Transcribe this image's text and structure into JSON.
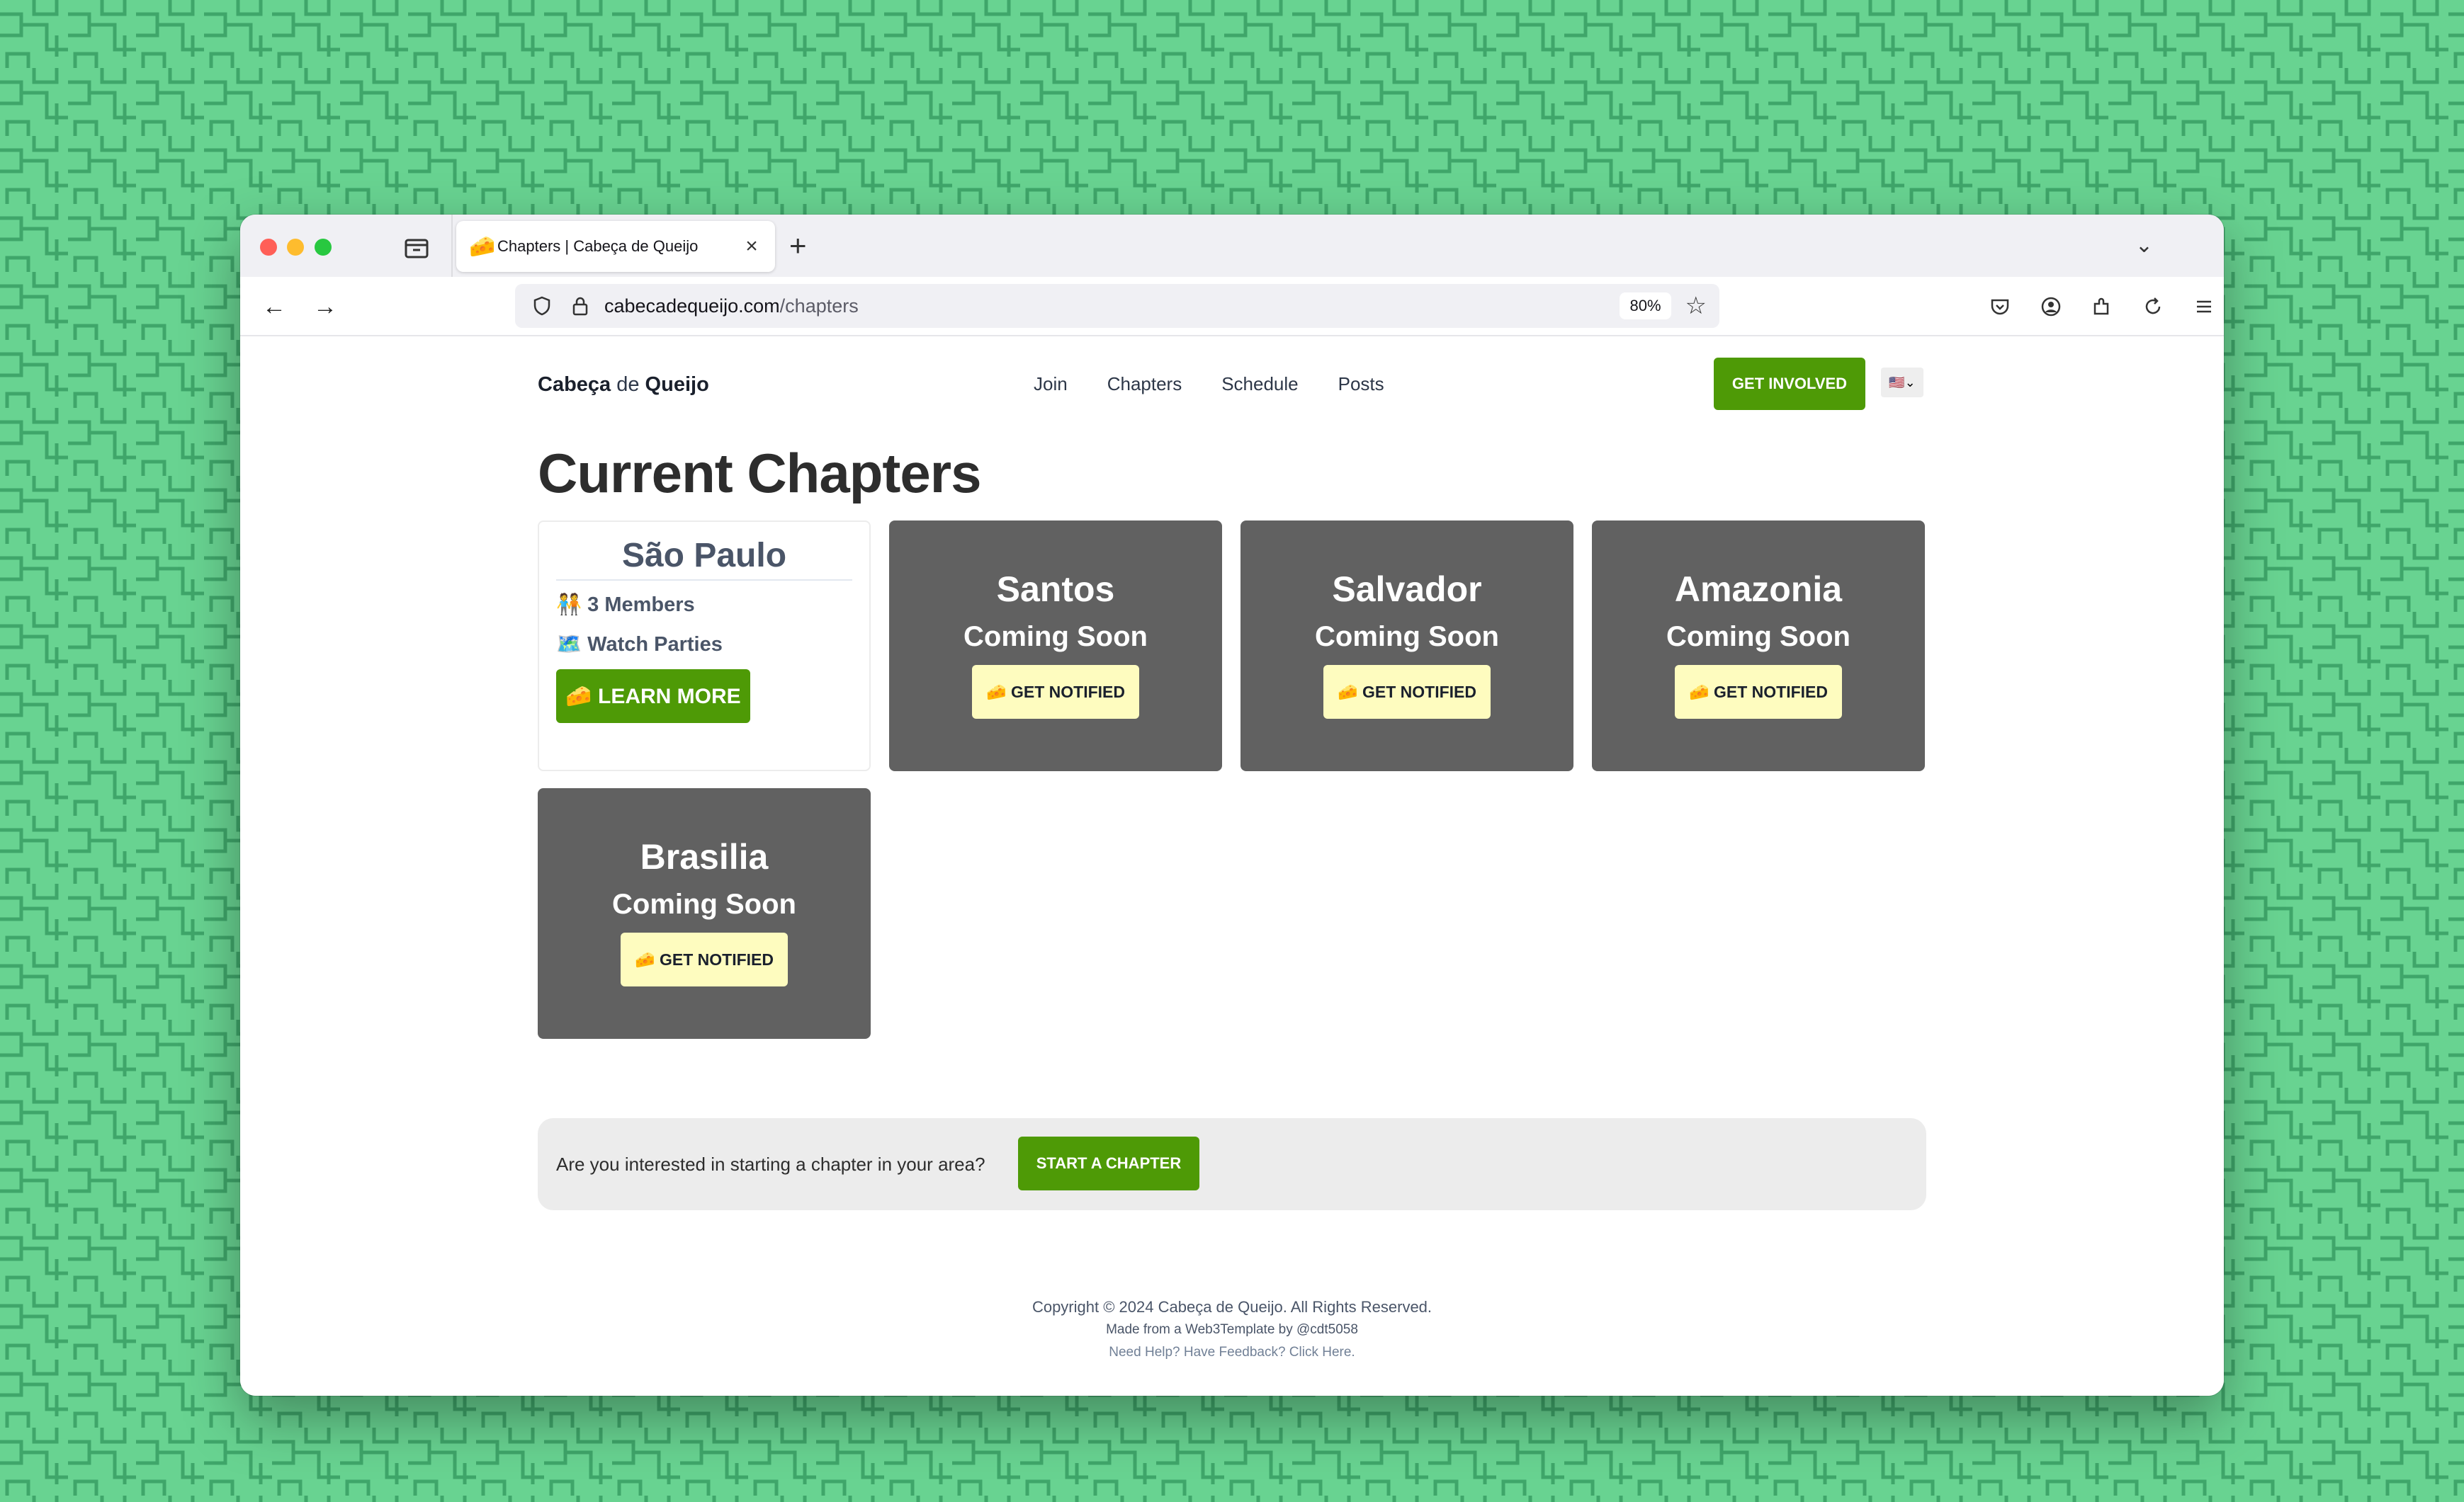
{
  "browser": {
    "tab_title": "Chapters | Cabeça de Queijo",
    "tab_favicon": "🧀",
    "url_domain": "cabecadequeijo.com",
    "url_path": "/chapters",
    "zoom": "80%"
  },
  "site": {
    "brand_start": "Cabeça ",
    "brand_de": "de",
    "brand_end": " Queijo",
    "nav": [
      "Join",
      "Chapters",
      "Schedule",
      "Posts"
    ],
    "cta_button": "GET INVOLVED",
    "language_flag": "🇺🇸",
    "language_chevron": "⌄"
  },
  "page": {
    "title": "Current Chapters",
    "active_chapter": {
      "city": "São Paulo",
      "members": "🧑‍🤝‍🧑 3 Members",
      "activity": "🗺️ Watch Parties",
      "button": "🧀 LEARN MORE"
    },
    "coming_soon": [
      {
        "city": "Santos",
        "status": "Coming Soon",
        "button": "🧀 GET NOTIFIED"
      },
      {
        "city": "Salvador",
        "status": "Coming Soon",
        "button": "🧀 GET NOTIFIED"
      },
      {
        "city": "Amazonia",
        "status": "Coming Soon",
        "button": "🧀 GET NOTIFIED"
      },
      {
        "city": "Brasilia",
        "status": "Coming Soon",
        "button": "🧀 GET NOTIFIED"
      }
    ],
    "cta": {
      "text": "Are you interested in starting a chapter in your area?",
      "button": "START A CHAPTER"
    }
  },
  "footer": {
    "copyright": "Copyright © 2024 Cabeça de Queijo. All Rights Reserved.",
    "made": "Made from a Web3Template by @cdt5058",
    "help": "Need Help? Have Feedback? Click Here."
  },
  "colors": {
    "background": "#68d391",
    "pattern_line": "#3fa66a",
    "accent_green": "#4e9a06",
    "card_gray": "#616161",
    "notify_yellow": "#fefcbf"
  }
}
